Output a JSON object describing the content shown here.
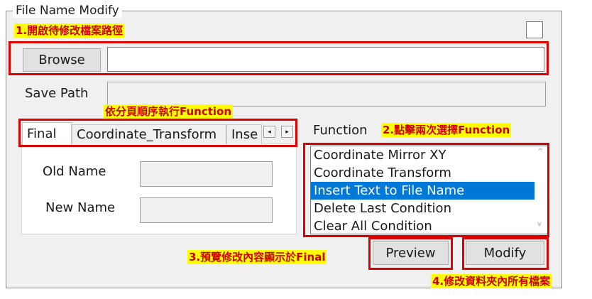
{
  "group": {
    "title": "File Name Modify"
  },
  "annotations": {
    "step1": "1.開啟待修改檔案路徑",
    "tabs_hint": "依分頁順序執行Function",
    "step2": "2.點擊兩次選擇Function",
    "step3": "3.預覽修改內容顯示於Final",
    "step4": "4.修改資料夾內所有檔案"
  },
  "browse": {
    "button_label": "Browse",
    "path_value": ""
  },
  "save_path": {
    "label": "Save Path",
    "value": ""
  },
  "tabs": [
    {
      "label": "Final"
    },
    {
      "label": "Coordinate_Transform"
    },
    {
      "label": "Inse"
    }
  ],
  "tab_scroll": {
    "left_icon": "◂",
    "right_icon": "▸"
  },
  "final_tab": {
    "old_name_label": "Old Name",
    "new_name_label": "New Name"
  },
  "function": {
    "label": "Function",
    "items": [
      {
        "label": "Coordinate Mirror XY",
        "selected": false
      },
      {
        "label": "Coordinate Transform",
        "selected": false
      },
      {
        "label": "Insert Text to File Name",
        "selected": true
      },
      {
        "label": "Delete Last Condition",
        "selected": false
      },
      {
        "label": "Clear All Condition",
        "selected": false
      }
    ],
    "scroll_up_icon": "^",
    "scroll_down_icon": "v"
  },
  "actions": {
    "preview_label": "Preview",
    "modify_label": "Modify"
  },
  "colors": {
    "highlight": "#dd0000",
    "tag_bg": "#ffff00",
    "selection": "#0078d7"
  }
}
